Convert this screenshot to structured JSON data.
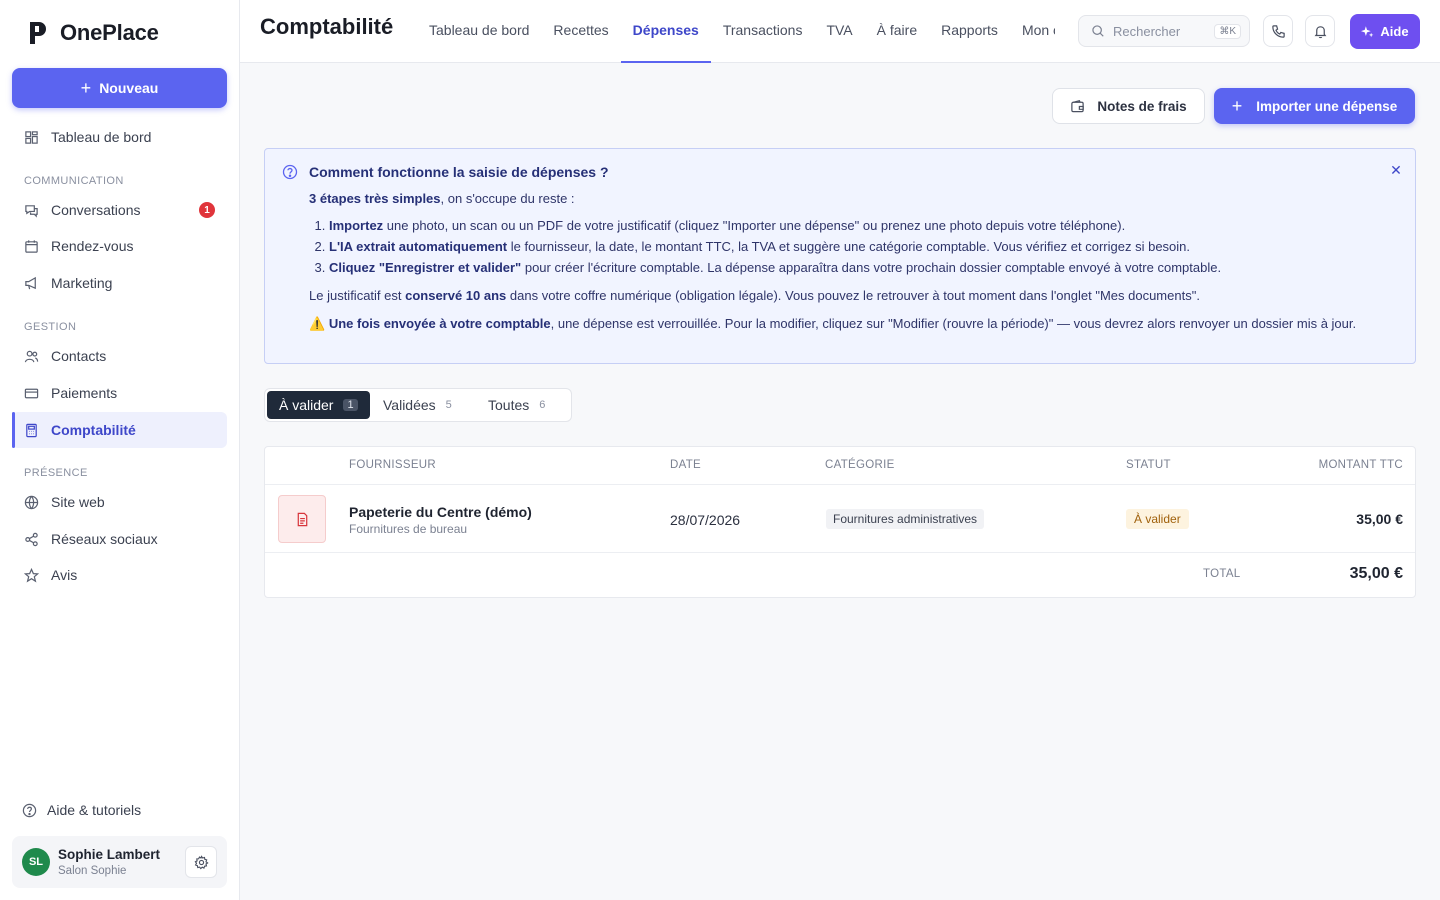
{
  "app": {
    "name": "OnePlace"
  },
  "sidebar": {
    "new_button": "Nouveau",
    "dashboard": "Tableau de bord",
    "section_communication": "COMMUNICATION",
    "conversations": "Conversations",
    "conversations_badge": "1",
    "appointments": "Rendez-vous",
    "marketing": "Marketing",
    "section_gestion": "GESTION",
    "contacts": "Contacts",
    "payments": "Paiements",
    "accounting": "Comptabilité",
    "section_presence": "PRÉSENCE",
    "website": "Site web",
    "social": "Réseaux sociaux",
    "reviews": "Avis",
    "help": "Aide & tutoriels",
    "user": {
      "initials": "SL",
      "name": "Sophie Lambert",
      "business": "Salon Sophie"
    }
  },
  "header": {
    "title": "Comptabilité",
    "tabs": [
      "Tableau de bord",
      "Recettes",
      "Dépenses",
      "Transactions",
      "TVA",
      "À faire",
      "Rapports",
      "Mon comptable"
    ],
    "active_tab": "Dépenses",
    "search_placeholder": "Rechercher",
    "search_shortcut": "⌘K",
    "aide": "Aide"
  },
  "actions": {
    "notes": "Notes de frais",
    "import": "Importer une dépense"
  },
  "info": {
    "title": "Comment fonctionne la saisie de dépenses ?",
    "intro_bold": "3 étapes très simples",
    "intro_rest": ", on s'occupe du reste :",
    "step1_bold": "Importez",
    "step1_rest": " une photo, un scan ou un PDF de votre justificatif (cliquez \"Importer une dépense\" ou prenez une photo depuis votre téléphone).",
    "step2_bold": "L'IA extrait automatiquement",
    "step2_rest": " le fournisseur, la date, le montant TTC, la TVA et suggère une catégorie comptable. Vous vérifiez et corrigez si besoin.",
    "step3_bold": "Cliquez \"Enregistrer et valider\"",
    "step3_rest": " pour créer l'écriture comptable. La dépense apparaîtra dans votre prochain dossier comptable envoyé à votre comptable.",
    "keep_a": "Le justificatif est ",
    "keep_bold": "conservé 10 ans",
    "keep_b": " dans votre coffre numérique (obligation légale). Vous pouvez le retrouver à tout moment dans l'onglet \"Mes documents\".",
    "warn_icon": "⚠️",
    "warn_bold": "Une fois envoyée à votre comptable",
    "warn_rest": ", une dépense est verrouillée. Pour la modifier, cliquez sur \"Modifier (rouvre la période)\" — vous devrez alors renvoyer un dossier mis à jour."
  },
  "filters": [
    {
      "label": "À valider",
      "count": "1",
      "active": true
    },
    {
      "label": "Validées",
      "count": "5",
      "active": false
    },
    {
      "label": "Toutes",
      "count": "6",
      "active": false
    }
  ],
  "table": {
    "columns": {
      "supplier": "FOURNISSEUR",
      "date": "DATE",
      "category": "CATÉGORIE",
      "status": "STATUT",
      "amount": "MONTANT TTC"
    },
    "rows": [
      {
        "supplier": "Papeterie du Centre (démo)",
        "sub": "Fournitures de bureau",
        "date": "28/07/2026",
        "category": "Fournitures administratives",
        "status": "À valider",
        "amount": "35,00 €"
      }
    ],
    "total_label": "TOTAL",
    "total": "35,00 €"
  },
  "colors": {
    "accent": "#5b64f0",
    "aide": "#6e4ff0",
    "badge": "#e0353b",
    "avatar": "#1f8a4c"
  }
}
